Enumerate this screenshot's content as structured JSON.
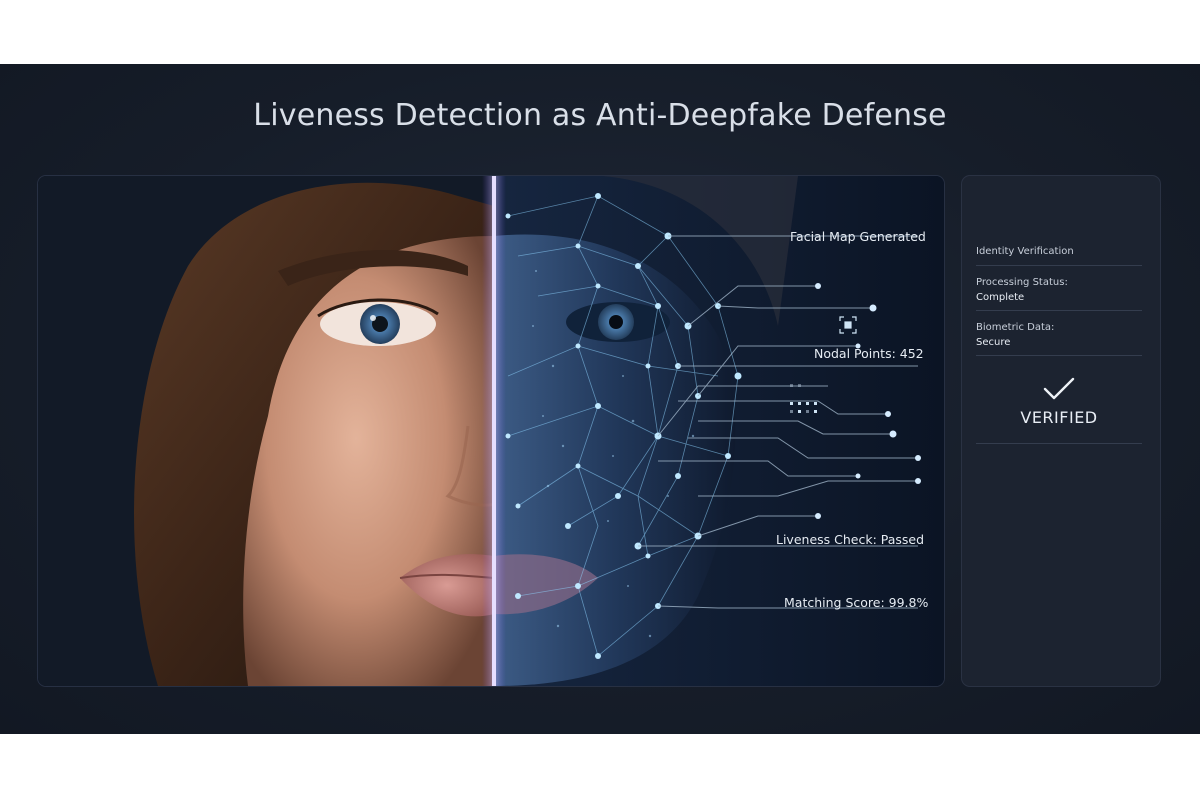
{
  "title": "Liveness Detection as Anti-Deepfake Defense",
  "callouts": {
    "facial_map": "Facial Map Generated",
    "nodal_points": "Nodal Points: 452",
    "liveness_check": "Liveness Check: Passed",
    "matching_score": "Matching Score: 99.8%"
  },
  "status_panel": {
    "identity_label": "Identity Verification",
    "processing_label": "Processing Status:",
    "processing_value": "Complete",
    "biometric_label": "Biometric Data:",
    "biometric_value": "Secure",
    "verified_icon": "checkmark-icon",
    "verified_label": "VERIFIED"
  },
  "colors": {
    "background": "#161d29",
    "scan_line": "#b9a8ff",
    "node_glow": "#8fd4ff"
  }
}
